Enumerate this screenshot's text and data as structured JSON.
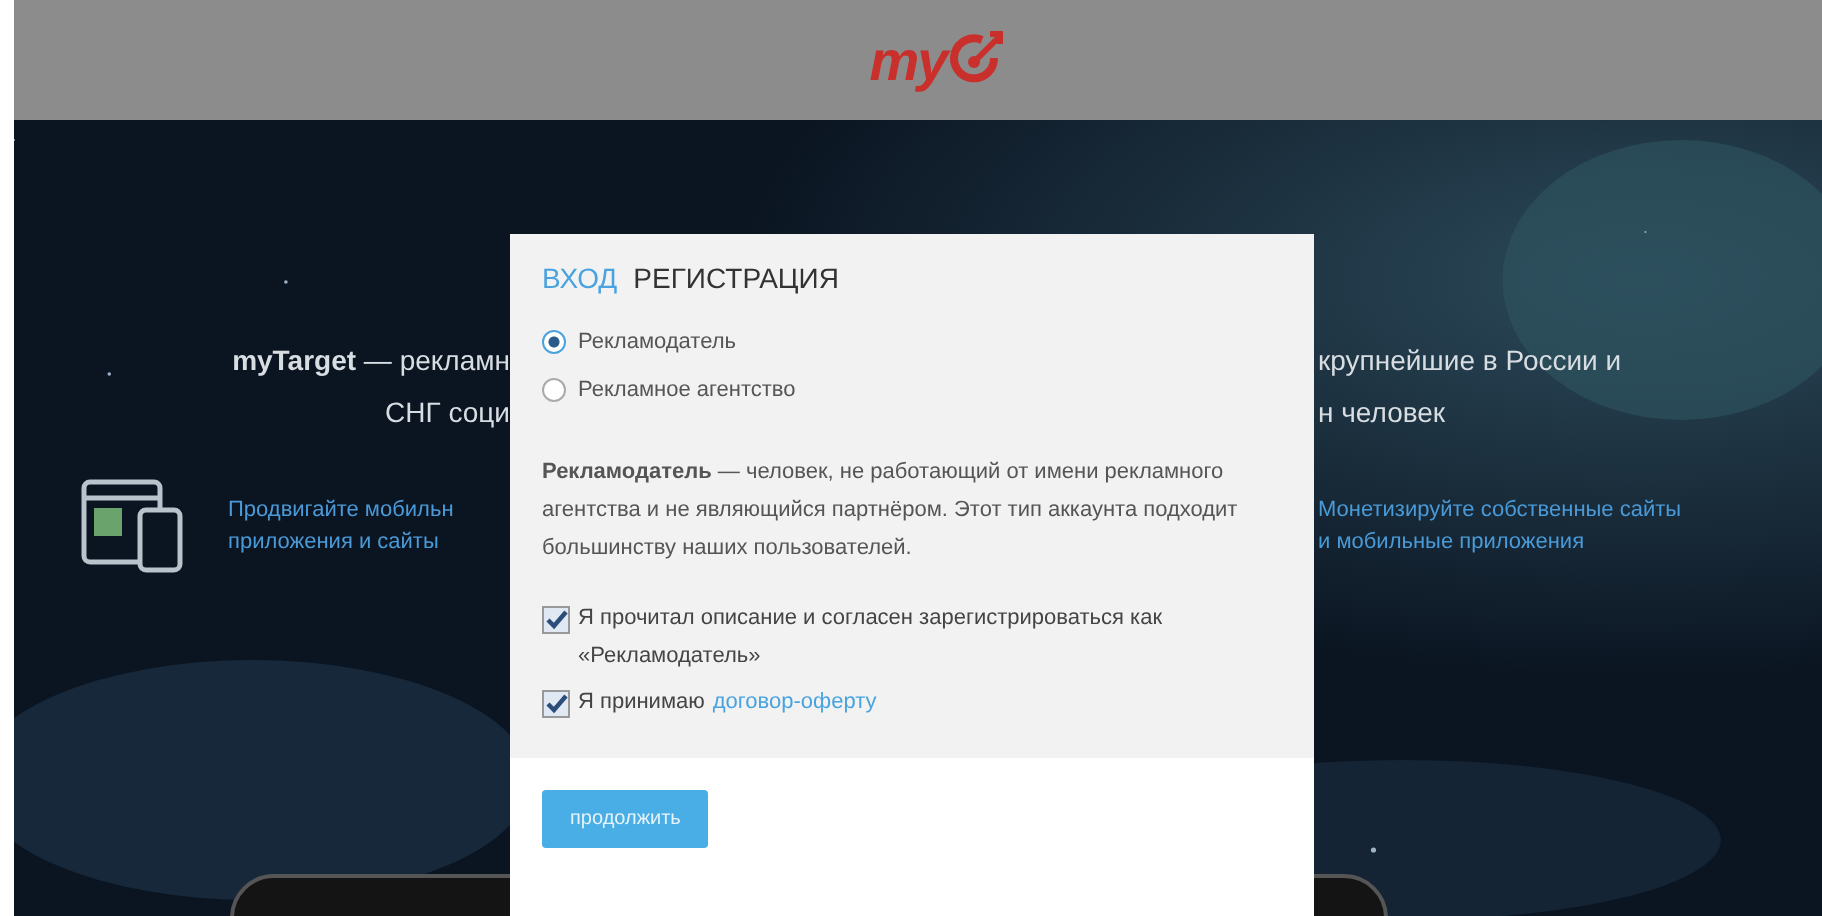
{
  "header": {
    "logo": "my"
  },
  "background": {
    "intro_lines": [
      {
        "left": "**myTarget** — рекламн",
        "right": "крупнейшие в России и"
      },
      {
        "left": "СНГ соци",
        "right": "н человек"
      }
    ],
    "features": [
      {
        "kind": "advertise",
        "lines": [
          "Продвигайте мобильн",
          "приложения и сайты"
        ]
      },
      {
        "kind": "monetize",
        "lines": [
          "Монетизируйте собственные сайты",
          "и мобильные приложения"
        ]
      }
    ]
  },
  "modal": {
    "tabs": [
      {
        "label": "ВХОД",
        "selected": false
      },
      {
        "label": "РЕГИСТРАЦИЯ",
        "selected": true
      }
    ],
    "account_types": [
      {
        "label": "Рекламодатель",
        "selected": true
      },
      {
        "label": "Рекламное агентство",
        "selected": false
      }
    ],
    "description": "**Рекламодатель** — человек, не работающий от имени рекламного агентства и не являющийся партнёром. Этот тип аккаунта подходит большинству наших пользователей.",
    "agreements": [
      {
        "text": "Я прочитал описание и согласен зарегистрироваться как «Рекламодатель»",
        "checked": true
      },
      {
        "text": "Я принимаю",
        "link": "договор-оферту",
        "checked": true
      }
    ],
    "submit": "продолжить"
  }
}
